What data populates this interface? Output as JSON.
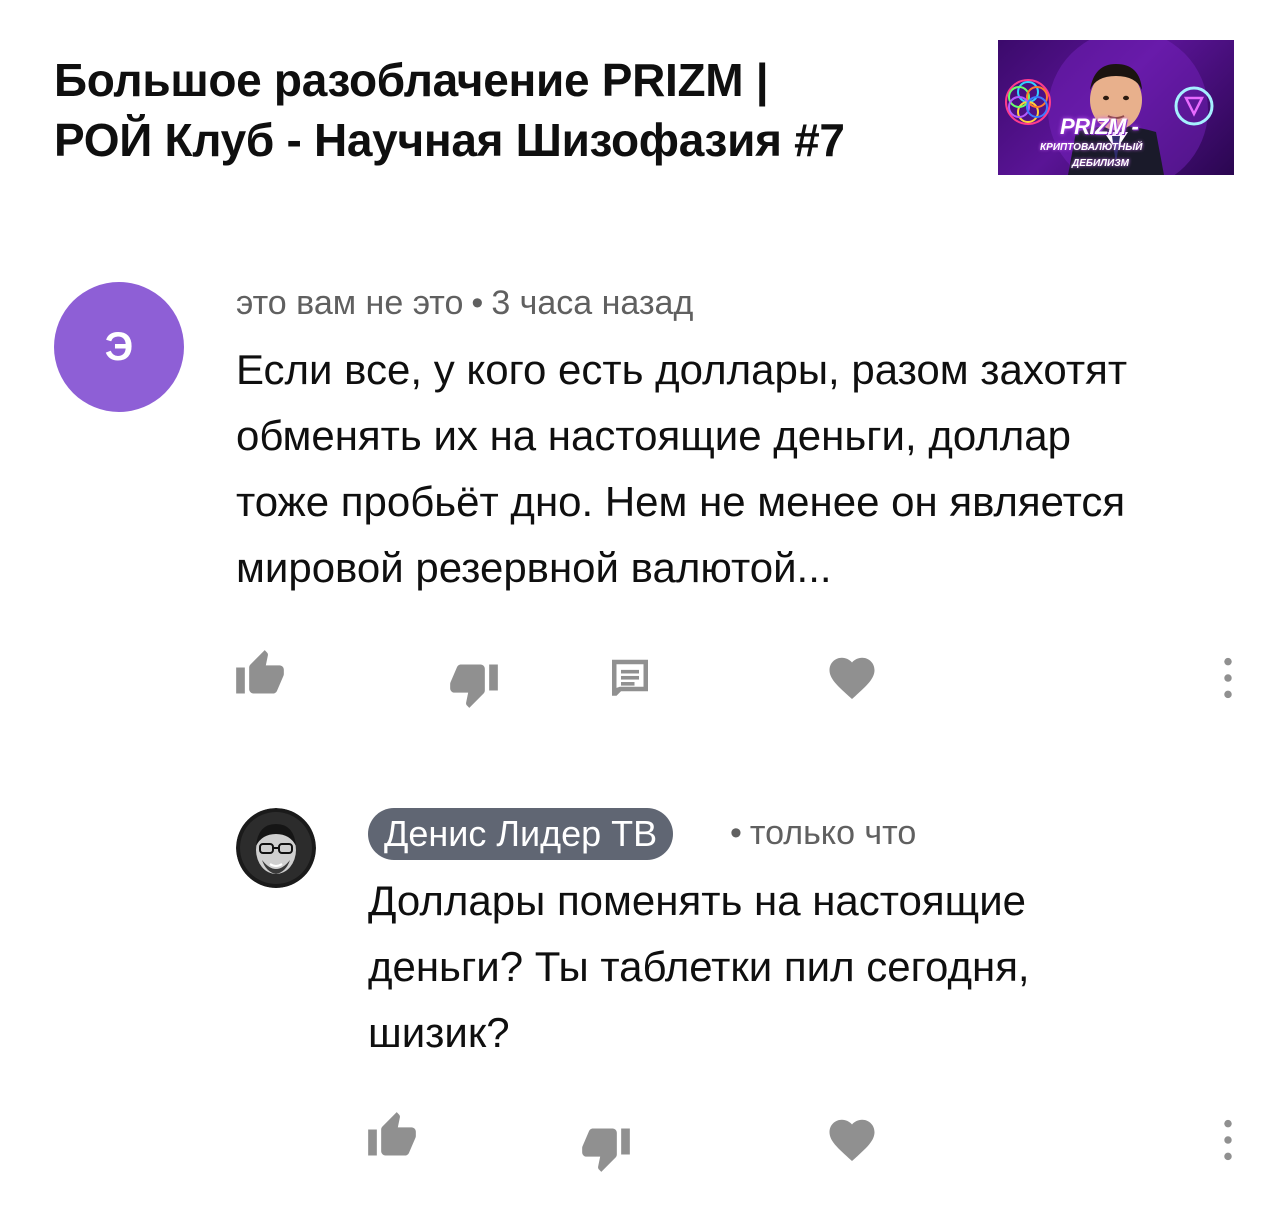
{
  "video": {
    "title_line1": "Большое разоблачение PRIZM |",
    "title_line2": "РОЙ Клуб - Научная Шизофазия #7",
    "thumbnail": {
      "brand": "PRIZM -",
      "subtitle1": "криптовалютный",
      "subtitle2": "дебилизм"
    }
  },
  "comment": {
    "avatar_letter": "Э",
    "avatar_color": "#8e5fd6",
    "author": "это вам не это",
    "separator": "•",
    "time": "3 часа назад",
    "text_lines": [
      "Если все, у кого есть доллары, разом захотят",
      "обменять их на настоящие деньги, доллар",
      "тоже пробьёт дно. Нем не менее он является",
      "мировой резервной валютой..."
    ],
    "actions": [
      "like-icon",
      "dislike-icon",
      "reply-icon",
      "heart-icon",
      "more-vert-icon"
    ]
  },
  "reply": {
    "author": "Денис Лидер ТВ",
    "author_chip_color": "#606673",
    "separator": "•",
    "time": "только что",
    "text_lines": [
      "Доллары поменять на настоящие",
      "деньги? Ты таблетки пил сегодня,",
      "шизик?"
    ],
    "actions": [
      "like-icon",
      "dislike-icon",
      "heart-icon",
      "more-vert-icon"
    ]
  },
  "colors": {
    "icon_gray": "#909090",
    "meta_gray": "#606060",
    "text": "#0f0f0f"
  }
}
